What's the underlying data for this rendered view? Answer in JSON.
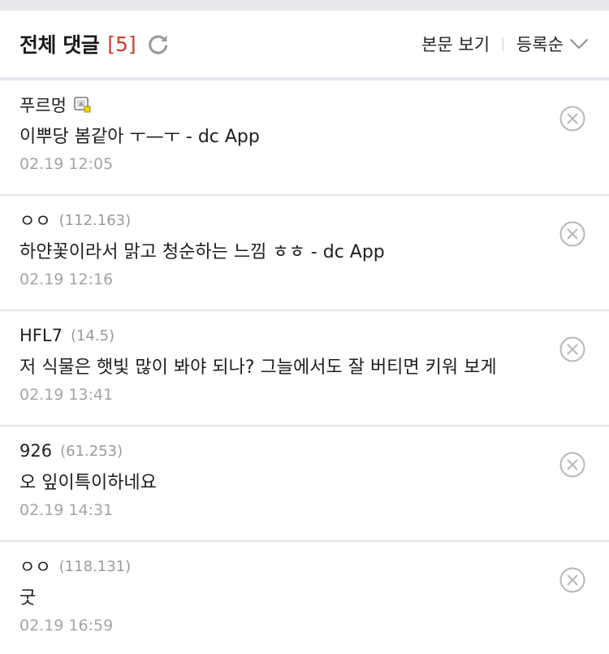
{
  "header": {
    "title": "전체 댓글",
    "count": "[5]",
    "view_body_label": "본문 보기",
    "sort_label": "등록순",
    "accent_color": "#d0392f"
  },
  "icons": {
    "refresh": "refresh-icon",
    "sort": "chevron-down-icon",
    "delete": "close-circle-icon",
    "member": "member-badge-icon"
  },
  "comments": [
    {
      "author": "푸르멍",
      "ip": "",
      "member_badge": true,
      "text": "이뿌당 봄같아 ㅜ—ㅜ - dc App",
      "date": "02.19 12:05"
    },
    {
      "author": "ㅇㅇ",
      "ip": "(112.163)",
      "member_badge": false,
      "text": "하얀꽃이라서 맑고 청순하는 느낌 ㅎㅎ - dc App",
      "date": "02.19 12:16"
    },
    {
      "author": "HFL7",
      "ip": "(14.5)",
      "member_badge": false,
      "text": "저 식물은 햇빛 많이 봐야 되나? 그늘에서도 잘 버티면 키워 보게",
      "date": "02.19 13:41"
    },
    {
      "author": "926",
      "ip": "(61.253)",
      "member_badge": false,
      "text": "오 잎이특이하네요",
      "date": "02.19 14:31"
    },
    {
      "author": "ㅇㅇ",
      "ip": "(118.131)",
      "member_badge": false,
      "text": "굿",
      "date": "02.19 16:59"
    }
  ]
}
